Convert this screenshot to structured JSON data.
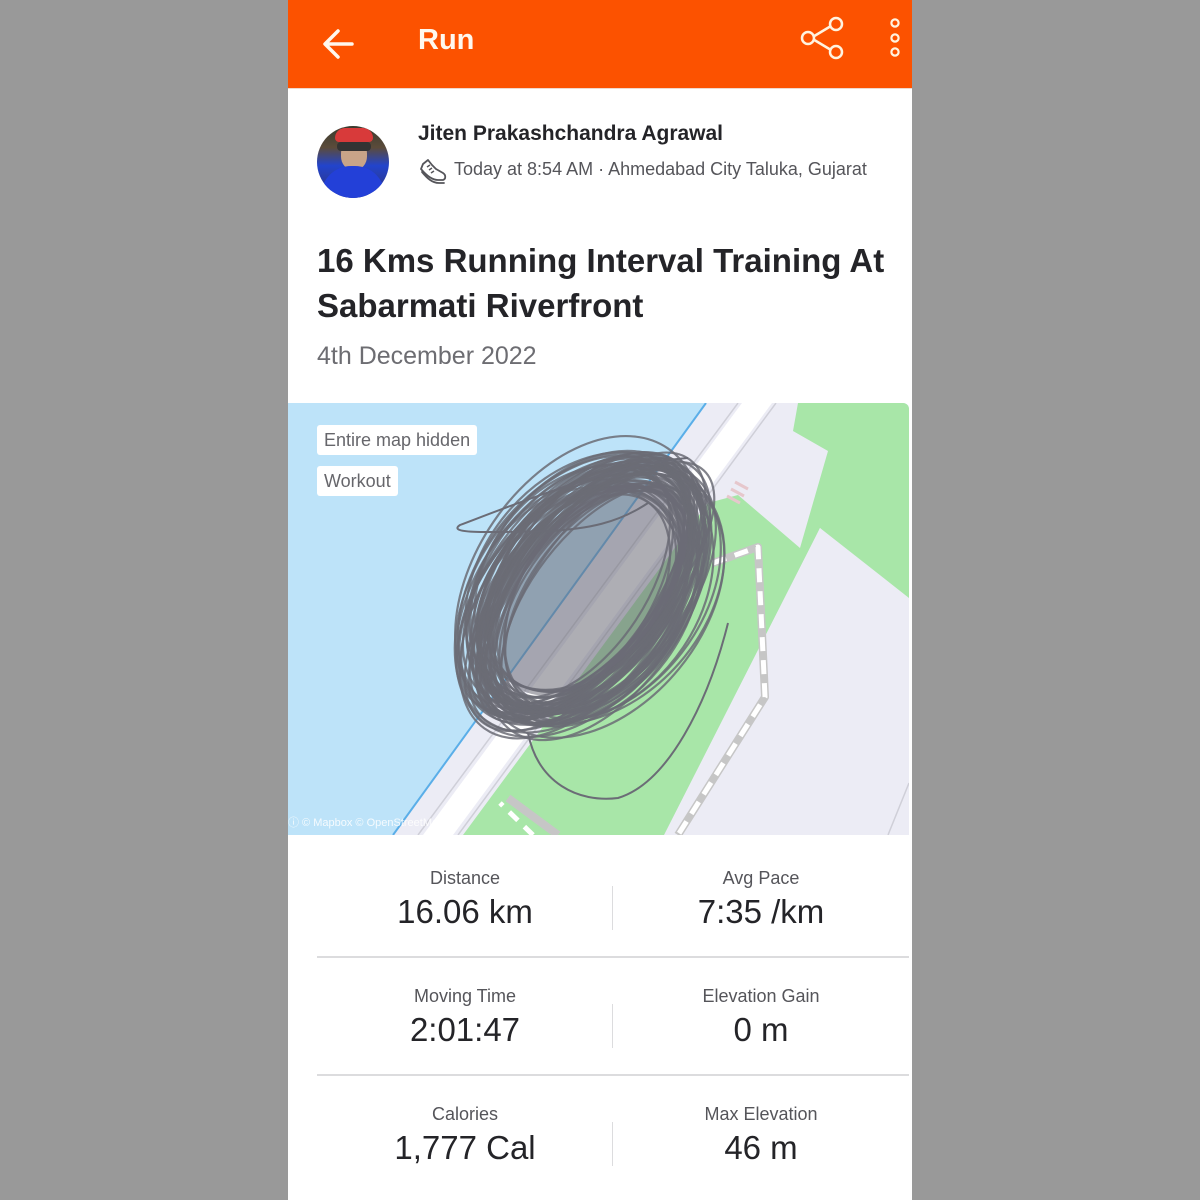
{
  "app": {
    "title": "Run",
    "brand_color": "#fc5200",
    "icons": {
      "back": "arrow-left-icon",
      "share": "share-icon",
      "more": "more-vertical-icon",
      "activity_type": "running-shoe-icon"
    }
  },
  "athlete": {
    "name": "Jiten Prakashchandra Agrawal",
    "avatar": "profile-photo"
  },
  "activity": {
    "meta": "Today at 8:54 AM · Ahmedabad City Taluka, Gujarat",
    "title": "16 Kms Running Interval Training At Sabarmati Riverfront",
    "date": "4th December 2022"
  },
  "map": {
    "chips": [
      "Entire map hidden",
      "Workout"
    ],
    "attribution": "ⓘ © Mapbox © OpenStreetMap",
    "colors": {
      "water": "#bde3f9",
      "park": "#a8e6a8",
      "land": "#ececf5",
      "route": "#6b6c76"
    }
  },
  "stats": [
    [
      {
        "label": "Distance",
        "value": "16.06 km"
      },
      {
        "label": "Avg Pace",
        "value": "7:35 /km"
      }
    ],
    [
      {
        "label": "Moving Time",
        "value": "2:01:47"
      },
      {
        "label": "Elevation Gain",
        "value": "0 m"
      }
    ],
    [
      {
        "label": "Calories",
        "value": "1,777 Cal"
      },
      {
        "label": "Max Elevation",
        "value": "46 m"
      }
    ]
  ]
}
